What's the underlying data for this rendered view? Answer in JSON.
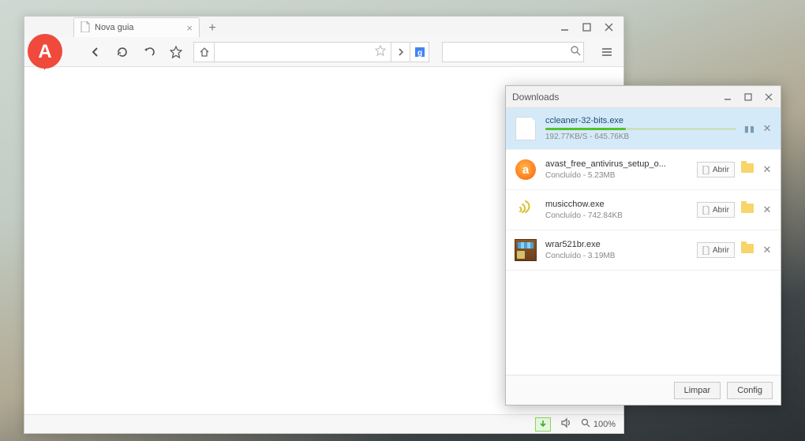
{
  "browser": {
    "tab_title": "Nova guia",
    "status": {
      "zoom_label": "100%"
    }
  },
  "downloads": {
    "title": "Downloads",
    "clear_label": "Limpar",
    "config_label": "Config",
    "open_label": "Abrir",
    "items": [
      {
        "name": "ccleaner-32-bits.exe",
        "status": "192.77KB/S - 645.76KB",
        "in_progress": true
      },
      {
        "name": "avast_free_antivirus_setup_o...",
        "status": "Concluído - 5.23MB",
        "in_progress": false
      },
      {
        "name": "musicchow.exe",
        "status": "Concluído - 742.84KB",
        "in_progress": false
      },
      {
        "name": "wrar521br.exe",
        "status": "Concluído - 3.19MB",
        "in_progress": false
      }
    ]
  }
}
